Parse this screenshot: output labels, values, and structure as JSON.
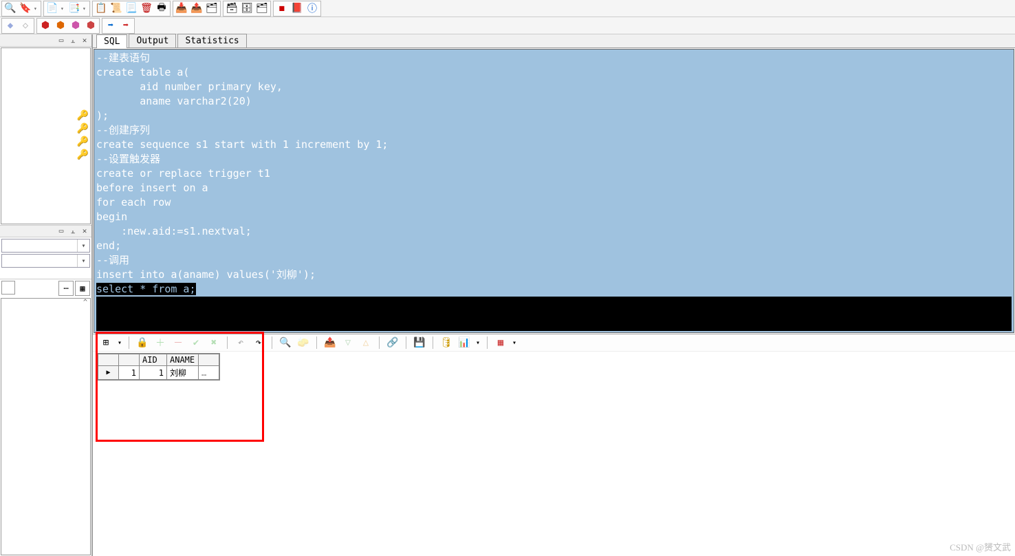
{
  "toolbar1": [
    "🔍",
    "🔖",
    "|",
    "📄",
    "▾",
    "📑",
    "▾",
    "|",
    "📋",
    "📜",
    "📃",
    "🖨",
    "🖶",
    "|",
    "📥",
    "📤",
    "🗂",
    "|",
    "🗃",
    "🗄",
    "🗂",
    "|",
    "🟥",
    "📕",
    "ℹ️"
  ],
  "toolbar2": [
    "💎",
    "⋄",
    "|",
    "🟥",
    "🟧",
    "🟨",
    "🟩",
    "|",
    "➡",
    "➡"
  ],
  "tabs": [
    {
      "label": "SQL",
      "active": true
    },
    {
      "label": "Output",
      "active": false
    },
    {
      "label": "Statistics",
      "active": false
    }
  ],
  "sql_lines": [
    "--建表语句",
    "create table a(",
    "       aid number primary key,",
    "       aname varchar2(20)",
    ");",
    "--创建序列",
    "create sequence s1 start with 1 increment by 1;",
    "--设置触发器",
    "create or replace trigger t1",
    "before insert on a",
    "for each row",
    "begin",
    "    :new.aid:=s1.nextval;",
    "end;",
    "--调用",
    "insert into a(aname) values('刘柳');"
  ],
  "sql_last_line": "select * from a;",
  "result_toolbar": [
    "⊞",
    "▾",
    "|",
    "🔒",
    "＋",
    "－",
    "✔",
    "✖",
    "|",
    "↶",
    "↷",
    "|",
    "🔍",
    "🧽",
    "|",
    "📤",
    "▽",
    "△",
    "|",
    "🔗",
    "|",
    "💾",
    "|",
    "🛢",
    "📊",
    "▾",
    "|",
    "🧱",
    "▾"
  ],
  "grid": {
    "headers": [
      "",
      "",
      "AID",
      "ANAME",
      ""
    ],
    "row": [
      "▶",
      "1",
      "1",
      "刘柳",
      "…"
    ]
  },
  "watermark": "CSDN @赟文武"
}
